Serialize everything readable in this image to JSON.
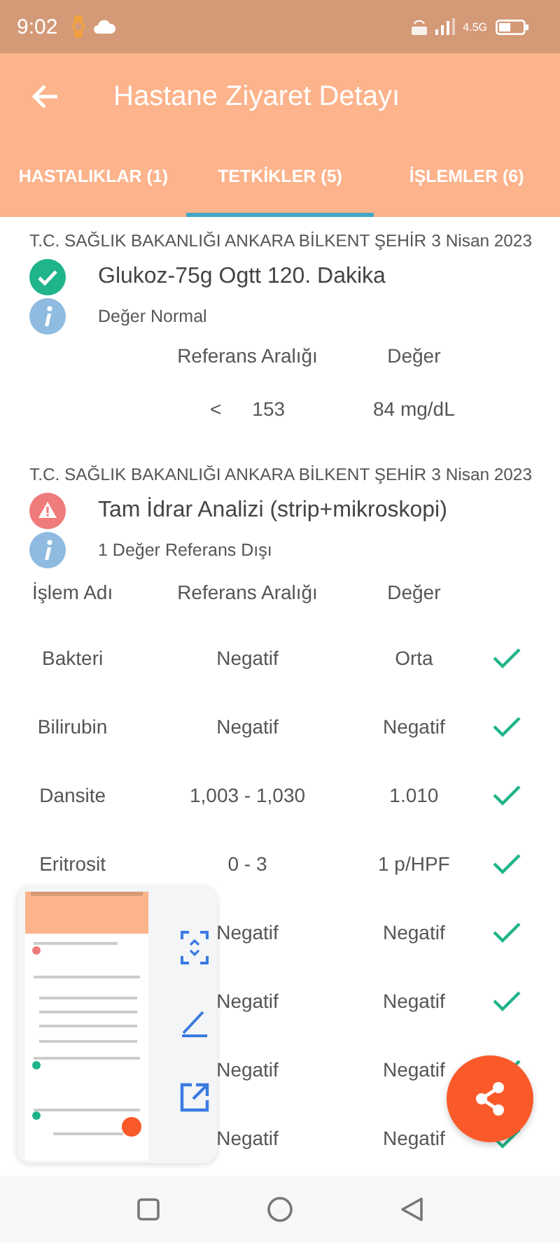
{
  "status_bar": {
    "time": "9:02",
    "network": "4.5G"
  },
  "app_bar": {
    "title": "Hastane Ziyaret Detayı"
  },
  "tabs": [
    {
      "label": "HASTALIKLAR (1)",
      "selected": false
    },
    {
      "label": "TETKİKLER (5)",
      "selected": true
    },
    {
      "label": "İŞLEMLER (6)",
      "selected": false
    }
  ],
  "tests": [
    {
      "institution": "T.C. SAĞLIK BAKANLIĞI ANKARA BİLKENT ŞEHİR",
      "date": "3 Nisan 2023",
      "kind": "normal",
      "name": "Glukoz-75g Ogtt 120. Dakika",
      "summary": "Değer Normal",
      "columns": {
        "reference": "Referans Aralığı",
        "value": "Değer"
      },
      "rows": [
        {
          "operator": "<",
          "reference": "153",
          "value": "84 mg/dL"
        }
      ]
    },
    {
      "institution": "T.C. SAĞLIK BAKANLIĞI ANKARA BİLKENT ŞEHİR",
      "date": "3 Nisan 2023",
      "kind": "warning",
      "name": "Tam İdrar Analizi (strip+mikroskopi)",
      "summary": "1 Değer Referans Dışı",
      "columns": {
        "name": "İşlem Adı",
        "reference": "Referans Aralığı",
        "value": "Değer"
      },
      "rows": [
        {
          "name": "Bakteri",
          "reference": "Negatif",
          "value": "Orta",
          "in_range": true
        },
        {
          "name": "Bilirubin",
          "reference": "Negatif",
          "value": "Negatif",
          "in_range": true
        },
        {
          "name": "Dansite",
          "reference": "1,003 - 1,030",
          "value": "1.010",
          "in_range": true
        },
        {
          "name": "Eritrosit",
          "reference": "0 - 3",
          "value": "1 p/HPF",
          "in_range": true
        },
        {
          "reference": "Negatif",
          "value": "Negatif",
          "in_range": true
        },
        {
          "reference": "Negatif",
          "value": "Negatif",
          "in_range": true
        },
        {
          "reference": "Negatif",
          "value": "Negatif",
          "in_range": true
        },
        {
          "reference": "Negatif",
          "value": "Negatif",
          "in_range": true
        }
      ]
    }
  ]
}
